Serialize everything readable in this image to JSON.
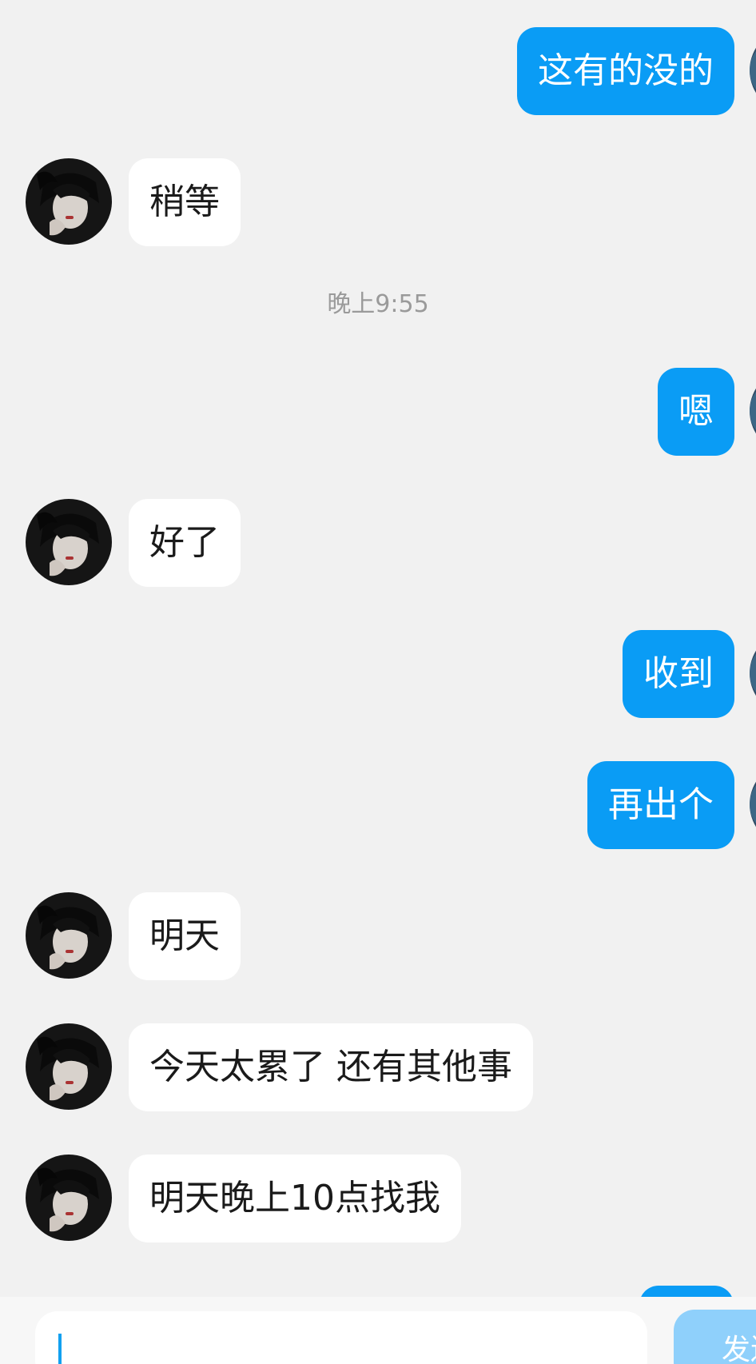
{
  "conversation": {
    "timestamp": "晚上9:55",
    "messages": [
      {
        "from": "self",
        "text": "这有的没的"
      },
      {
        "from": "other",
        "text": "稍等"
      },
      {
        "from": "self",
        "text": "嗯"
      },
      {
        "from": "other",
        "text": "好了"
      },
      {
        "from": "self",
        "text": "收到"
      },
      {
        "from": "self",
        "text": "再出个"
      },
      {
        "from": "other",
        "text": "明天"
      },
      {
        "from": "other",
        "text": "今天太累了 还有其他事"
      },
      {
        "from": "other",
        "text": "明天晚上10点找我"
      }
    ]
  },
  "composer": {
    "input_value": "",
    "send_label": "发送"
  },
  "colors": {
    "background": "#f1f1f1",
    "outgoing_bubble": "#0a9cf5",
    "incoming_bubble": "#ffffff",
    "send_button_disabled": "#8fd0fb"
  }
}
